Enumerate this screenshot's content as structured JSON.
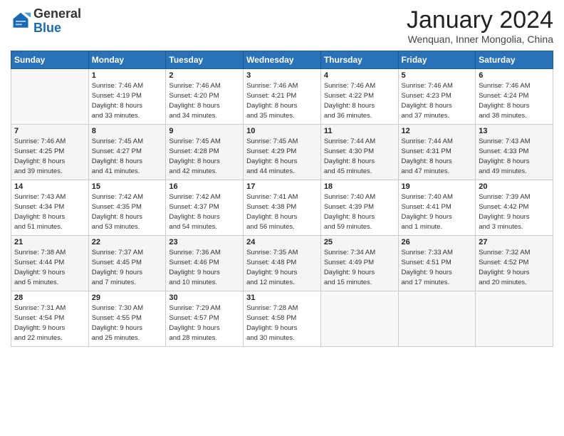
{
  "header": {
    "logo_line1": "General",
    "logo_line2": "Blue",
    "month": "January 2024",
    "location": "Wenquan, Inner Mongolia, China"
  },
  "weekdays": [
    "Sunday",
    "Monday",
    "Tuesday",
    "Wednesday",
    "Thursday",
    "Friday",
    "Saturday"
  ],
  "weeks": [
    [
      {
        "day": "",
        "sunrise": "",
        "sunset": "",
        "daylight": ""
      },
      {
        "day": "1",
        "sunrise": "Sunrise: 7:46 AM",
        "sunset": "Sunset: 4:19 PM",
        "daylight": "Daylight: 8 hours and 33 minutes."
      },
      {
        "day": "2",
        "sunrise": "Sunrise: 7:46 AM",
        "sunset": "Sunset: 4:20 PM",
        "daylight": "Daylight: 8 hours and 34 minutes."
      },
      {
        "day": "3",
        "sunrise": "Sunrise: 7:46 AM",
        "sunset": "Sunset: 4:21 PM",
        "daylight": "Daylight: 8 hours and 35 minutes."
      },
      {
        "day": "4",
        "sunrise": "Sunrise: 7:46 AM",
        "sunset": "Sunset: 4:22 PM",
        "daylight": "Daylight: 8 hours and 36 minutes."
      },
      {
        "day": "5",
        "sunrise": "Sunrise: 7:46 AM",
        "sunset": "Sunset: 4:23 PM",
        "daylight": "Daylight: 8 hours and 37 minutes."
      },
      {
        "day": "6",
        "sunrise": "Sunrise: 7:46 AM",
        "sunset": "Sunset: 4:24 PM",
        "daylight": "Daylight: 8 hours and 38 minutes."
      }
    ],
    [
      {
        "day": "7",
        "sunrise": "Sunrise: 7:46 AM",
        "sunset": "Sunset: 4:25 PM",
        "daylight": "Daylight: 8 hours and 39 minutes."
      },
      {
        "day": "8",
        "sunrise": "Sunrise: 7:45 AM",
        "sunset": "Sunset: 4:27 PM",
        "daylight": "Daylight: 8 hours and 41 minutes."
      },
      {
        "day": "9",
        "sunrise": "Sunrise: 7:45 AM",
        "sunset": "Sunset: 4:28 PM",
        "daylight": "Daylight: 8 hours and 42 minutes."
      },
      {
        "day": "10",
        "sunrise": "Sunrise: 7:45 AM",
        "sunset": "Sunset: 4:29 PM",
        "daylight": "Daylight: 8 hours and 44 minutes."
      },
      {
        "day": "11",
        "sunrise": "Sunrise: 7:44 AM",
        "sunset": "Sunset: 4:30 PM",
        "daylight": "Daylight: 8 hours and 45 minutes."
      },
      {
        "day": "12",
        "sunrise": "Sunrise: 7:44 AM",
        "sunset": "Sunset: 4:31 PM",
        "daylight": "Daylight: 8 hours and 47 minutes."
      },
      {
        "day": "13",
        "sunrise": "Sunrise: 7:43 AM",
        "sunset": "Sunset: 4:33 PM",
        "daylight": "Daylight: 8 hours and 49 minutes."
      }
    ],
    [
      {
        "day": "14",
        "sunrise": "Sunrise: 7:43 AM",
        "sunset": "Sunset: 4:34 PM",
        "daylight": "Daylight: 8 hours and 51 minutes."
      },
      {
        "day": "15",
        "sunrise": "Sunrise: 7:42 AM",
        "sunset": "Sunset: 4:35 PM",
        "daylight": "Daylight: 8 hours and 53 minutes."
      },
      {
        "day": "16",
        "sunrise": "Sunrise: 7:42 AM",
        "sunset": "Sunset: 4:37 PM",
        "daylight": "Daylight: 8 hours and 54 minutes."
      },
      {
        "day": "17",
        "sunrise": "Sunrise: 7:41 AM",
        "sunset": "Sunset: 4:38 PM",
        "daylight": "Daylight: 8 hours and 56 minutes."
      },
      {
        "day": "18",
        "sunrise": "Sunrise: 7:40 AM",
        "sunset": "Sunset: 4:39 PM",
        "daylight": "Daylight: 8 hours and 59 minutes."
      },
      {
        "day": "19",
        "sunrise": "Sunrise: 7:40 AM",
        "sunset": "Sunset: 4:41 PM",
        "daylight": "Daylight: 9 hours and 1 minute."
      },
      {
        "day": "20",
        "sunrise": "Sunrise: 7:39 AM",
        "sunset": "Sunset: 4:42 PM",
        "daylight": "Daylight: 9 hours and 3 minutes."
      }
    ],
    [
      {
        "day": "21",
        "sunrise": "Sunrise: 7:38 AM",
        "sunset": "Sunset: 4:44 PM",
        "daylight": "Daylight: 9 hours and 5 minutes."
      },
      {
        "day": "22",
        "sunrise": "Sunrise: 7:37 AM",
        "sunset": "Sunset: 4:45 PM",
        "daylight": "Daylight: 9 hours and 7 minutes."
      },
      {
        "day": "23",
        "sunrise": "Sunrise: 7:36 AM",
        "sunset": "Sunset: 4:46 PM",
        "daylight": "Daylight: 9 hours and 10 minutes."
      },
      {
        "day": "24",
        "sunrise": "Sunrise: 7:35 AM",
        "sunset": "Sunset: 4:48 PM",
        "daylight": "Daylight: 9 hours and 12 minutes."
      },
      {
        "day": "25",
        "sunrise": "Sunrise: 7:34 AM",
        "sunset": "Sunset: 4:49 PM",
        "daylight": "Daylight: 9 hours and 15 minutes."
      },
      {
        "day": "26",
        "sunrise": "Sunrise: 7:33 AM",
        "sunset": "Sunset: 4:51 PM",
        "daylight": "Daylight: 9 hours and 17 minutes."
      },
      {
        "day": "27",
        "sunrise": "Sunrise: 7:32 AM",
        "sunset": "Sunset: 4:52 PM",
        "daylight": "Daylight: 9 hours and 20 minutes."
      }
    ],
    [
      {
        "day": "28",
        "sunrise": "Sunrise: 7:31 AM",
        "sunset": "Sunset: 4:54 PM",
        "daylight": "Daylight: 9 hours and 22 minutes."
      },
      {
        "day": "29",
        "sunrise": "Sunrise: 7:30 AM",
        "sunset": "Sunset: 4:55 PM",
        "daylight": "Daylight: 9 hours and 25 minutes."
      },
      {
        "day": "30",
        "sunrise": "Sunrise: 7:29 AM",
        "sunset": "Sunset: 4:57 PM",
        "daylight": "Daylight: 9 hours and 28 minutes."
      },
      {
        "day": "31",
        "sunrise": "Sunrise: 7:28 AM",
        "sunset": "Sunset: 4:58 PM",
        "daylight": "Daylight: 9 hours and 30 minutes."
      },
      {
        "day": "",
        "sunrise": "",
        "sunset": "",
        "daylight": ""
      },
      {
        "day": "",
        "sunrise": "",
        "sunset": "",
        "daylight": ""
      },
      {
        "day": "",
        "sunrise": "",
        "sunset": "",
        "daylight": ""
      }
    ]
  ]
}
